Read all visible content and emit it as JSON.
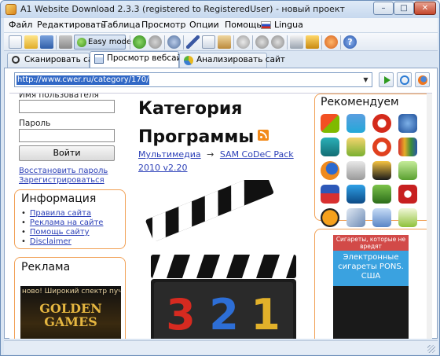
{
  "window": {
    "title": "A1 Website Download 2.3.3 (registered to RegisteredUser) - новый проект",
    "controls": {
      "minimize": "–",
      "maximize": "□",
      "close": "✕"
    }
  },
  "menu": [
    "Файл",
    "Редактировать",
    "Таблица",
    "Просмотр",
    "Опции",
    "Помощь",
    "Lingua"
  ],
  "toolbar": {
    "easy_mode_label": "Easy mode"
  },
  "tabs": [
    {
      "label": "Сканировать сайт",
      "icon": "magnifier-icon",
      "active": false
    },
    {
      "label": "Просмотр вебсайта",
      "icon": "document-icon",
      "active": true
    },
    {
      "label": "Анализировать сайт",
      "icon": "pie-icon",
      "active": false
    }
  ],
  "address_bar": {
    "url": "http://www.cwer.ru/category/170/"
  },
  "webpage": {
    "login": {
      "username_label": "Имя пользователя",
      "password_label": "Пароль",
      "login_button": "Войти",
      "restore_link": "Восстановить пароль",
      "register_link": "Зарегистрироваться"
    },
    "info": {
      "title": "Информация",
      "links": [
        "Правила сайта",
        "Реклама на сайте",
        "Помощь сайту",
        "Disclaimer"
      ]
    },
    "ads": {
      "title": "Реклама",
      "golden_line": "ново! Широкий спектр пуч",
      "golden_title": "GOLDEN GAMES",
      "pons_warning": "Сигареты, которые не вредят",
      "pons_body": "Электронные сигареты PONS. США"
    },
    "category": {
      "line1": "Категория",
      "line2": "Программы",
      "breadcrumb_parent": "Мультимедиа",
      "breadcrumb_arrow": "→",
      "breadcrumb_item": "SAM CoDeC Pack 2010 v2.20"
    },
    "clapper_digits": [
      "3",
      "2",
      "1"
    ],
    "recommend": {
      "title": "Рекомендуем"
    }
  },
  "colors": {
    "box_border": "#f1a055",
    "link": "#2b3fb7",
    "selection": "#3168c6"
  }
}
